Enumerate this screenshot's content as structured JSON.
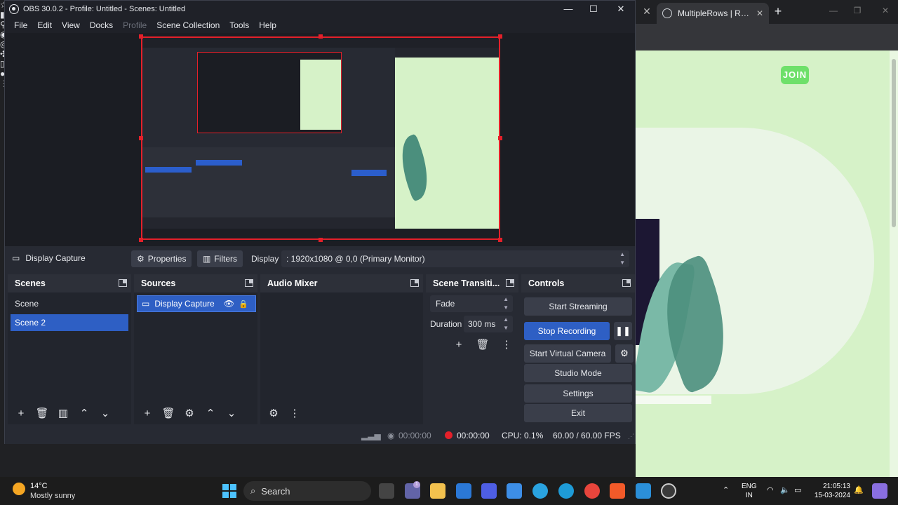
{
  "browser": {
    "tab_title": "MultipleRows | React",
    "join_button": "JOIN",
    "colors": {
      "page_bg": "#d6f2c8",
      "join_green": "#6ee06a"
    }
  },
  "obs": {
    "title": "OBS 30.0.2 - Profile: Untitled - Scenes: Untitled",
    "menu": [
      "File",
      "Edit",
      "View",
      "Docks",
      "Profile",
      "Scene Collection",
      "Tools",
      "Help"
    ],
    "source_toolbar": {
      "source_name": "Display Capture",
      "properties_label": "Properties",
      "filters_label": "Filters",
      "display_label": "Display",
      "display_value": ": 1920x1080 @ 0,0 (Primary Monitor)"
    },
    "docks": {
      "scenes": {
        "title": "Scenes",
        "items": [
          "Scene",
          "Scene 2"
        ],
        "selected": "Scene 2"
      },
      "sources": {
        "title": "Sources",
        "items": [
          "Display Capture"
        ]
      },
      "audio_mixer": {
        "title": "Audio Mixer"
      },
      "transitions": {
        "title": "Scene Transiti...",
        "transition": "Fade",
        "duration_label": "Duration",
        "duration_value": "300 ms"
      },
      "controls": {
        "title": "Controls",
        "start_streaming": "Start Streaming",
        "stop_recording": "Stop Recording",
        "start_virtual_camera": "Start Virtual Camera",
        "studio_mode": "Studio Mode",
        "settings": "Settings",
        "exit": "Exit"
      }
    },
    "status": {
      "stream_time": "00:00:00",
      "rec_time": "00:00:00",
      "cpu": "CPU: 0.1%",
      "fps": "60.00 / 60.00 FPS"
    },
    "colors": {
      "accent": "#2e5fc4",
      "record_red": "#e4202a"
    }
  },
  "taskbar": {
    "temperature": "14°C",
    "weather": "Mostly sunny",
    "search_label": "Search",
    "notification_count": "1",
    "lang_line1": "ENG",
    "lang_line2": "IN",
    "time": "21:05:13",
    "date": "15-03-2024"
  }
}
